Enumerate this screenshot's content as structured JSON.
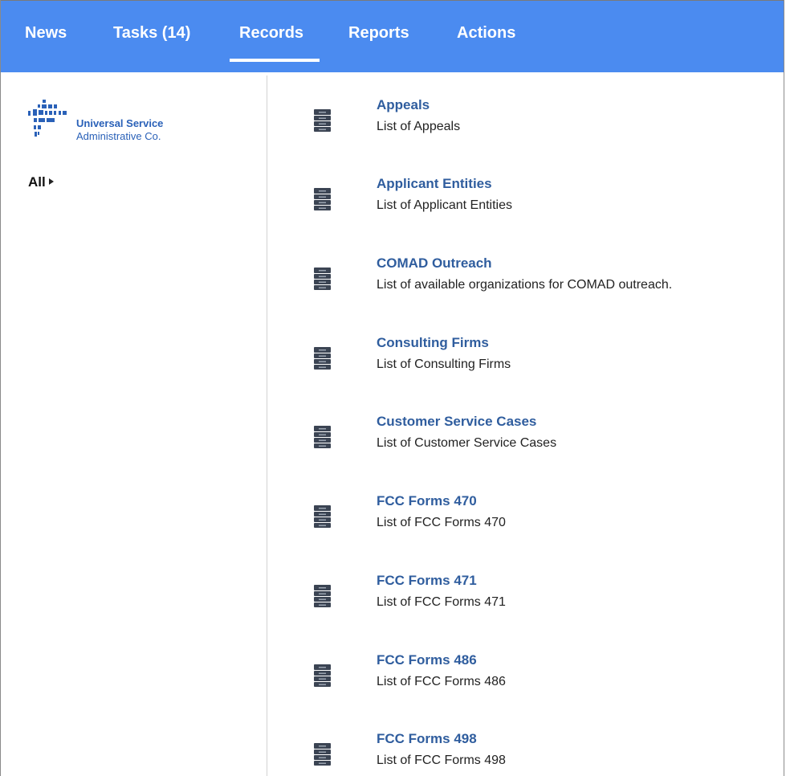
{
  "nav": {
    "tabs": [
      {
        "label": "News"
      },
      {
        "label": "Tasks (14)"
      },
      {
        "label": "Records"
      },
      {
        "label": "Reports"
      },
      {
        "label": "Actions"
      }
    ],
    "active": "Records",
    "color": "#4b8bf0"
  },
  "logo": {
    "line1": "Universal Service",
    "line2": "Administrative Co."
  },
  "filter": {
    "label": "All"
  },
  "records": [
    {
      "title": "Appeals",
      "description": "List of Appeals",
      "icon": "records-cabinet-icon"
    },
    {
      "title": "Applicant Entities",
      "description": "List of Applicant Entities",
      "icon": "records-cabinet-icon"
    },
    {
      "title": "COMAD Outreach",
      "description": "List of available organizations for COMAD outreach.",
      "icon": "records-cabinet-icon"
    },
    {
      "title": "Consulting Firms",
      "description": "List of Consulting Firms",
      "icon": "records-cabinet-icon"
    },
    {
      "title": "Customer Service Cases",
      "description": "List of Customer Service Cases",
      "icon": "records-cabinet-icon"
    },
    {
      "title": "FCC Forms 470",
      "description": "List of FCC Forms 470",
      "icon": "records-cabinet-icon"
    },
    {
      "title": "FCC Forms 471",
      "description": "List of FCC Forms 471",
      "icon": "records-cabinet-icon"
    },
    {
      "title": "FCC Forms 486",
      "description": "List of FCC Forms 486",
      "icon": "records-cabinet-icon"
    },
    {
      "title": "FCC Forms 498",
      "description": "List of FCC Forms 498",
      "icon": "records-cabinet-icon"
    }
  ]
}
